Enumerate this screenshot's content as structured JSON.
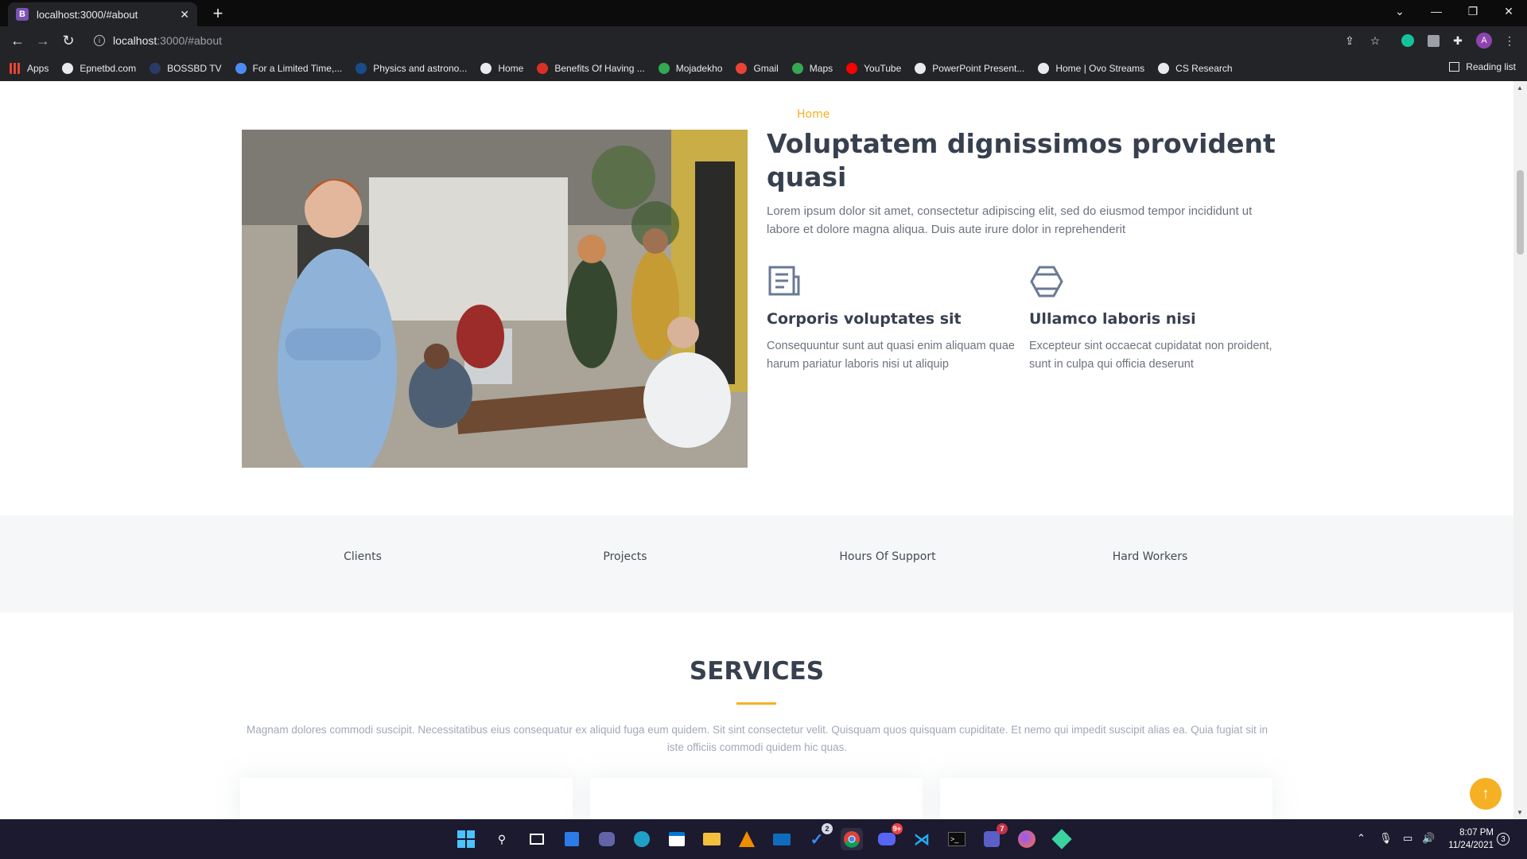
{
  "browser": {
    "tab_title": "localhost:3000/#about",
    "tab_favicon_letter": "B",
    "url_host": "localhost",
    "url_path": ":3000/#about",
    "bookmarks": [
      {
        "label": "Apps",
        "icon": "apps-grid-icon",
        "color": "#ea4335"
      },
      {
        "label": "Epnetbd.com",
        "icon": "globe-icon",
        "color": "#e8eaed"
      },
      {
        "label": "BOSSBD TV",
        "icon": "bossbd-icon",
        "color": "#2b3a67"
      },
      {
        "label": "For a Limited Time,...",
        "icon": "page-icon",
        "color": "#4c8bf5"
      },
      {
        "label": "Physics and astrono...",
        "icon": "physics-icon",
        "color": "#1a4b8c"
      },
      {
        "label": "Home",
        "icon": "globe-icon",
        "color": "#e8eaed"
      },
      {
        "label": "Benefits Of Having ...",
        "icon": "benefits-icon",
        "color": "#d93025"
      },
      {
        "label": "Mojadekho",
        "icon": "mojadekho-icon",
        "color": "#34a853"
      },
      {
        "label": "Gmail",
        "icon": "gmail-icon",
        "color": "#ea4335"
      },
      {
        "label": "Maps",
        "icon": "maps-icon",
        "color": "#34a853"
      },
      {
        "label": "YouTube",
        "icon": "youtube-icon",
        "color": "#ff0000"
      },
      {
        "label": "PowerPoint Present...",
        "icon": "globe-icon",
        "color": "#e8eaed"
      },
      {
        "label": "Home | Ovo Streams",
        "icon": "globe-icon",
        "color": "#e8eaed"
      },
      {
        "label": "CS Research",
        "icon": "globe-icon",
        "color": "#e8eaed"
      }
    ],
    "reading_list": "Reading list",
    "profile_initial": "A"
  },
  "about": {
    "kicker": "Home",
    "title": "Voluptatem dignissimos provident quasi",
    "lead": "Lorem ipsum dolor sit amet, consectetur adipiscing elit, sed do eiusmod tempor incididunt ut labore et dolore magna aliqua. Duis aute irure dolor in reprehenderit",
    "features": [
      {
        "icon": "newspaper-icon",
        "title": "Corporis voluptates sit",
        "text": "Consequuntur sunt aut quasi enim aliquam quae harum pariatur laboris nisi ut aliquip"
      },
      {
        "icon": "hexagon-icon",
        "title": "Ullamco laboris nisi",
        "text": "Excepteur sint occaecat cupidatat non proident, sunt in culpa qui officia deserunt"
      }
    ]
  },
  "counts": [
    "Clients",
    "Projects",
    "Hours Of Support",
    "Hard Workers"
  ],
  "services": {
    "title": "SERVICES",
    "description": "Magnam dolores commodi suscipit. Necessitatibus eius consequatur ex aliquid fuga eum quidem. Sit sint consectetur velit. Quisquam quos quisquam cupiditate. Et nemo qui impedit suscipit alias ea. Quia fugiat sit in iste officiis commodi quidem hic quas."
  },
  "colors": {
    "accent": "#f6b024",
    "heading": "#37404f",
    "body": "#6d737d"
  },
  "taskbar": {
    "badges": {
      "todo": "2",
      "discord": "9+",
      "teams": "7"
    },
    "time": "8:07 PM",
    "date": "11/24/2021",
    "notifications": "3"
  }
}
